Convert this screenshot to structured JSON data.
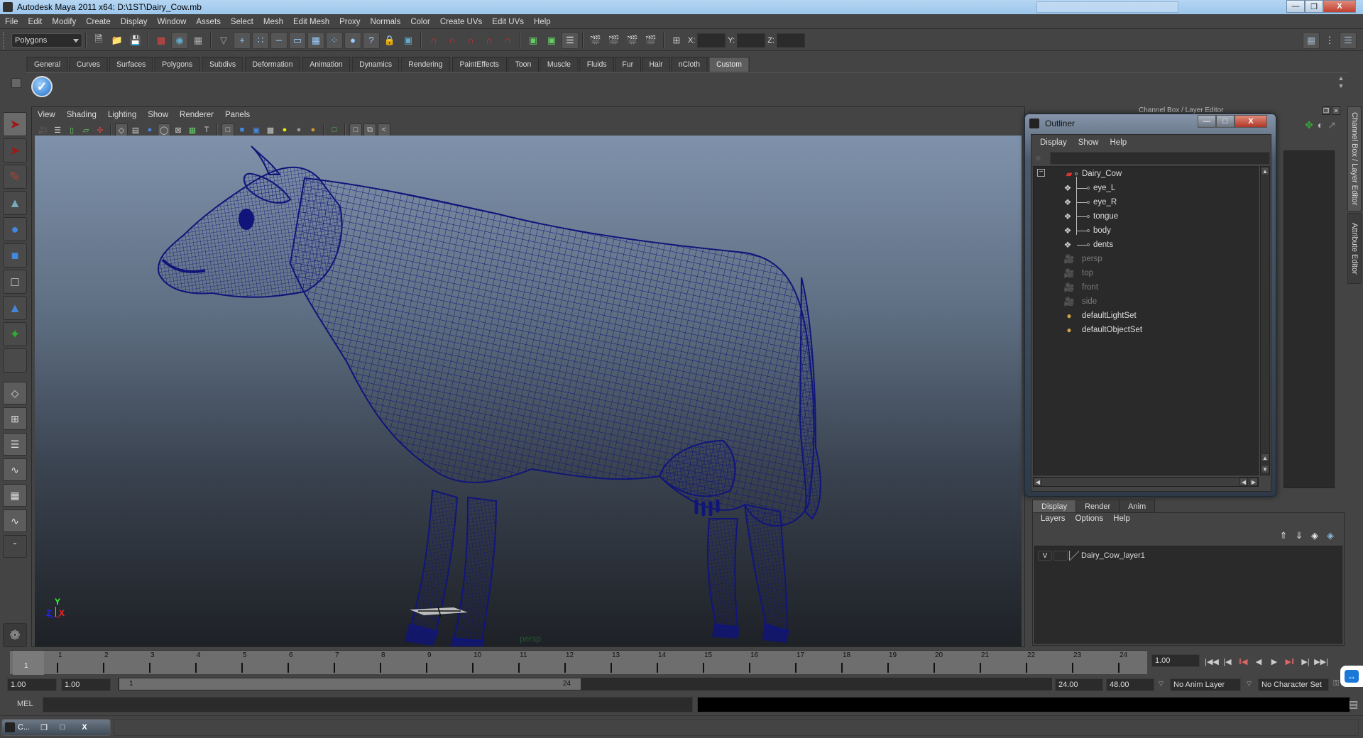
{
  "window": {
    "title": "Autodesk Maya 2011 x64: D:\\1ST\\Dairy_Cow.mb",
    "minimize_icon": "minimize-icon",
    "restore_icon": "restore-icon",
    "close_icon": "close-icon",
    "close_label": "X"
  },
  "menubar": [
    "File",
    "Edit",
    "Modify",
    "Create",
    "Display",
    "Window",
    "Assets",
    "Select",
    "Mesh",
    "Edit Mesh",
    "Proxy",
    "Normals",
    "Color",
    "Create UVs",
    "Edit UVs",
    "Help"
  ],
  "statusline": {
    "menu_set": "Polygons",
    "coord_labels": {
      "x": "X:",
      "y": "Y:",
      "z": "Z:"
    },
    "coord_values": {
      "x": "",
      "y": "",
      "z": ""
    },
    "icons_left": [
      "new-scene-icon",
      "open-scene-icon",
      "save-scene-icon"
    ],
    "select_mode_icons": [
      "hierarchy-mode-icon",
      "object-mode-icon",
      "component-mode-icon"
    ],
    "select_mask_icons": [
      "handles-icon",
      "joints-icon",
      "curves-icon",
      "surfaces-icon",
      "deformations-icon",
      "dynamics-icon",
      "rendering-icon",
      "misc-icon"
    ],
    "snap_icons": [
      "snap-grid-icon",
      "snap-curve-icon",
      "snap-point-icon",
      "snap-view-plane-icon",
      "snap-live-icon"
    ],
    "right_icons": [
      "show-attribute-editor-icon",
      "show-tool-settings-icon",
      "show-channel-box-icon"
    ]
  },
  "shelf": {
    "tabs": [
      "General",
      "Curves",
      "Surfaces",
      "Polygons",
      "Subdivs",
      "Deformation",
      "Animation",
      "Dynamics",
      "Rendering",
      "PaintEffects",
      "Toon",
      "Muscle",
      "Fluids",
      "Fur",
      "Hair",
      "nCloth",
      "Custom"
    ],
    "active_tab": "Custom",
    "items": [
      {
        "icon": "checkmark-icon"
      }
    ]
  },
  "toolbox": {
    "tools": [
      "select-tool-icon",
      "lasso-tool-icon",
      "paint-select-tool-icon",
      "move-tool-icon",
      "rotate-tool-icon",
      "scale-tool-icon",
      "universal-manipulator-icon",
      "soft-modify-icon",
      "show-manipulator-icon",
      "last-tool-icon"
    ],
    "layouts": [
      "single-perspective-layout",
      "four-view-layout",
      "outliner-persp-layout",
      "persp-graph-layout",
      "hypershade-persp-layout",
      "persp-graph-hypergraph-layout"
    ],
    "more_label": "ˇ"
  },
  "viewport": {
    "menu": [
      "View",
      "Shading",
      "Lighting",
      "Show",
      "Renderer",
      "Panels"
    ],
    "camera_label": "persp",
    "axis": {
      "x": "X",
      "y": "Y",
      "z": "Z"
    },
    "mesh_color": "#10157a",
    "bg_top": "#7f92ab",
    "bg_bottom": "#1e2126"
  },
  "outliner": {
    "title": "Outliner",
    "menu": [
      "Display",
      "Show",
      "Help"
    ],
    "filter": "",
    "items": [
      {
        "label": "Dairy_Cow",
        "type": "transform",
        "depth": 0,
        "expanded": true,
        "dim": false
      },
      {
        "label": "eye_L",
        "type": "mesh",
        "depth": 1,
        "dim": false
      },
      {
        "label": "eye_R",
        "type": "mesh",
        "depth": 1,
        "dim": false
      },
      {
        "label": "tongue",
        "type": "mesh",
        "depth": 1,
        "dim": false
      },
      {
        "label": "body",
        "type": "mesh",
        "depth": 1,
        "dim": false
      },
      {
        "label": "dents",
        "type": "mesh",
        "depth": 1,
        "dim": false
      },
      {
        "label": "persp",
        "type": "camera",
        "depth": 0,
        "dim": true
      },
      {
        "label": "top",
        "type": "camera",
        "depth": 0,
        "dim": true
      },
      {
        "label": "front",
        "type": "camera",
        "depth": 0,
        "dim": true
      },
      {
        "label": "side",
        "type": "camera",
        "depth": 0,
        "dim": true
      },
      {
        "label": "defaultLightSet",
        "type": "set",
        "depth": 0,
        "dim": false
      },
      {
        "label": "defaultObjectSet",
        "type": "set",
        "depth": 0,
        "dim": false
      }
    ],
    "collapse_label": "−"
  },
  "channelbox": {
    "header": "Channel Box / Layer Editor",
    "side_tabs": [
      "Channel Box / Layer Editor",
      "Attribute Editor"
    ]
  },
  "layer_editor": {
    "tabs": [
      "Display",
      "Render",
      "Anim"
    ],
    "active_tab": "Display",
    "menu": [
      "Layers",
      "Options",
      "Help"
    ],
    "icons": [
      "move-layer-up-icon",
      "move-layer-down-icon",
      "create-empty-layer-icon",
      "create-layer-from-selected-icon"
    ],
    "layers": [
      {
        "visible": "V",
        "playback": "",
        "name": "Dairy_Cow_layer1"
      }
    ]
  },
  "timeline": {
    "start": 1,
    "end": 24,
    "ticks": [
      1,
      2,
      3,
      4,
      5,
      6,
      7,
      8,
      9,
      10,
      11,
      12,
      13,
      14,
      15,
      16,
      17,
      18,
      19,
      20,
      21,
      22,
      23,
      24
    ],
    "current_frame": 1,
    "current_time_field": "1.00"
  },
  "playback": {
    "buttons": [
      "go-to-start-icon",
      "step-back-key-icon",
      "step-back-frame-icon",
      "play-backwards-icon",
      "play-forwards-icon",
      "step-forward-frame-icon",
      "step-forward-key-icon",
      "go-to-end-icon"
    ],
    "glyphs": [
      "|◀◀",
      "|◀",
      "‖◀",
      "◀",
      "▶",
      "▶‖",
      "▶|",
      "▶▶|"
    ]
  },
  "range": {
    "anim_start": "1.00",
    "playback_start": "1.00",
    "slider_start": "1",
    "slider_end": "24",
    "playback_end": "24.00",
    "anim_end": "48.00",
    "anim_layer": "No Anim Layer",
    "character_set": "No Character Set"
  },
  "cmdline": {
    "label": "MEL",
    "input": "",
    "result": ""
  },
  "taskbar": {
    "window_label": "C..."
  }
}
